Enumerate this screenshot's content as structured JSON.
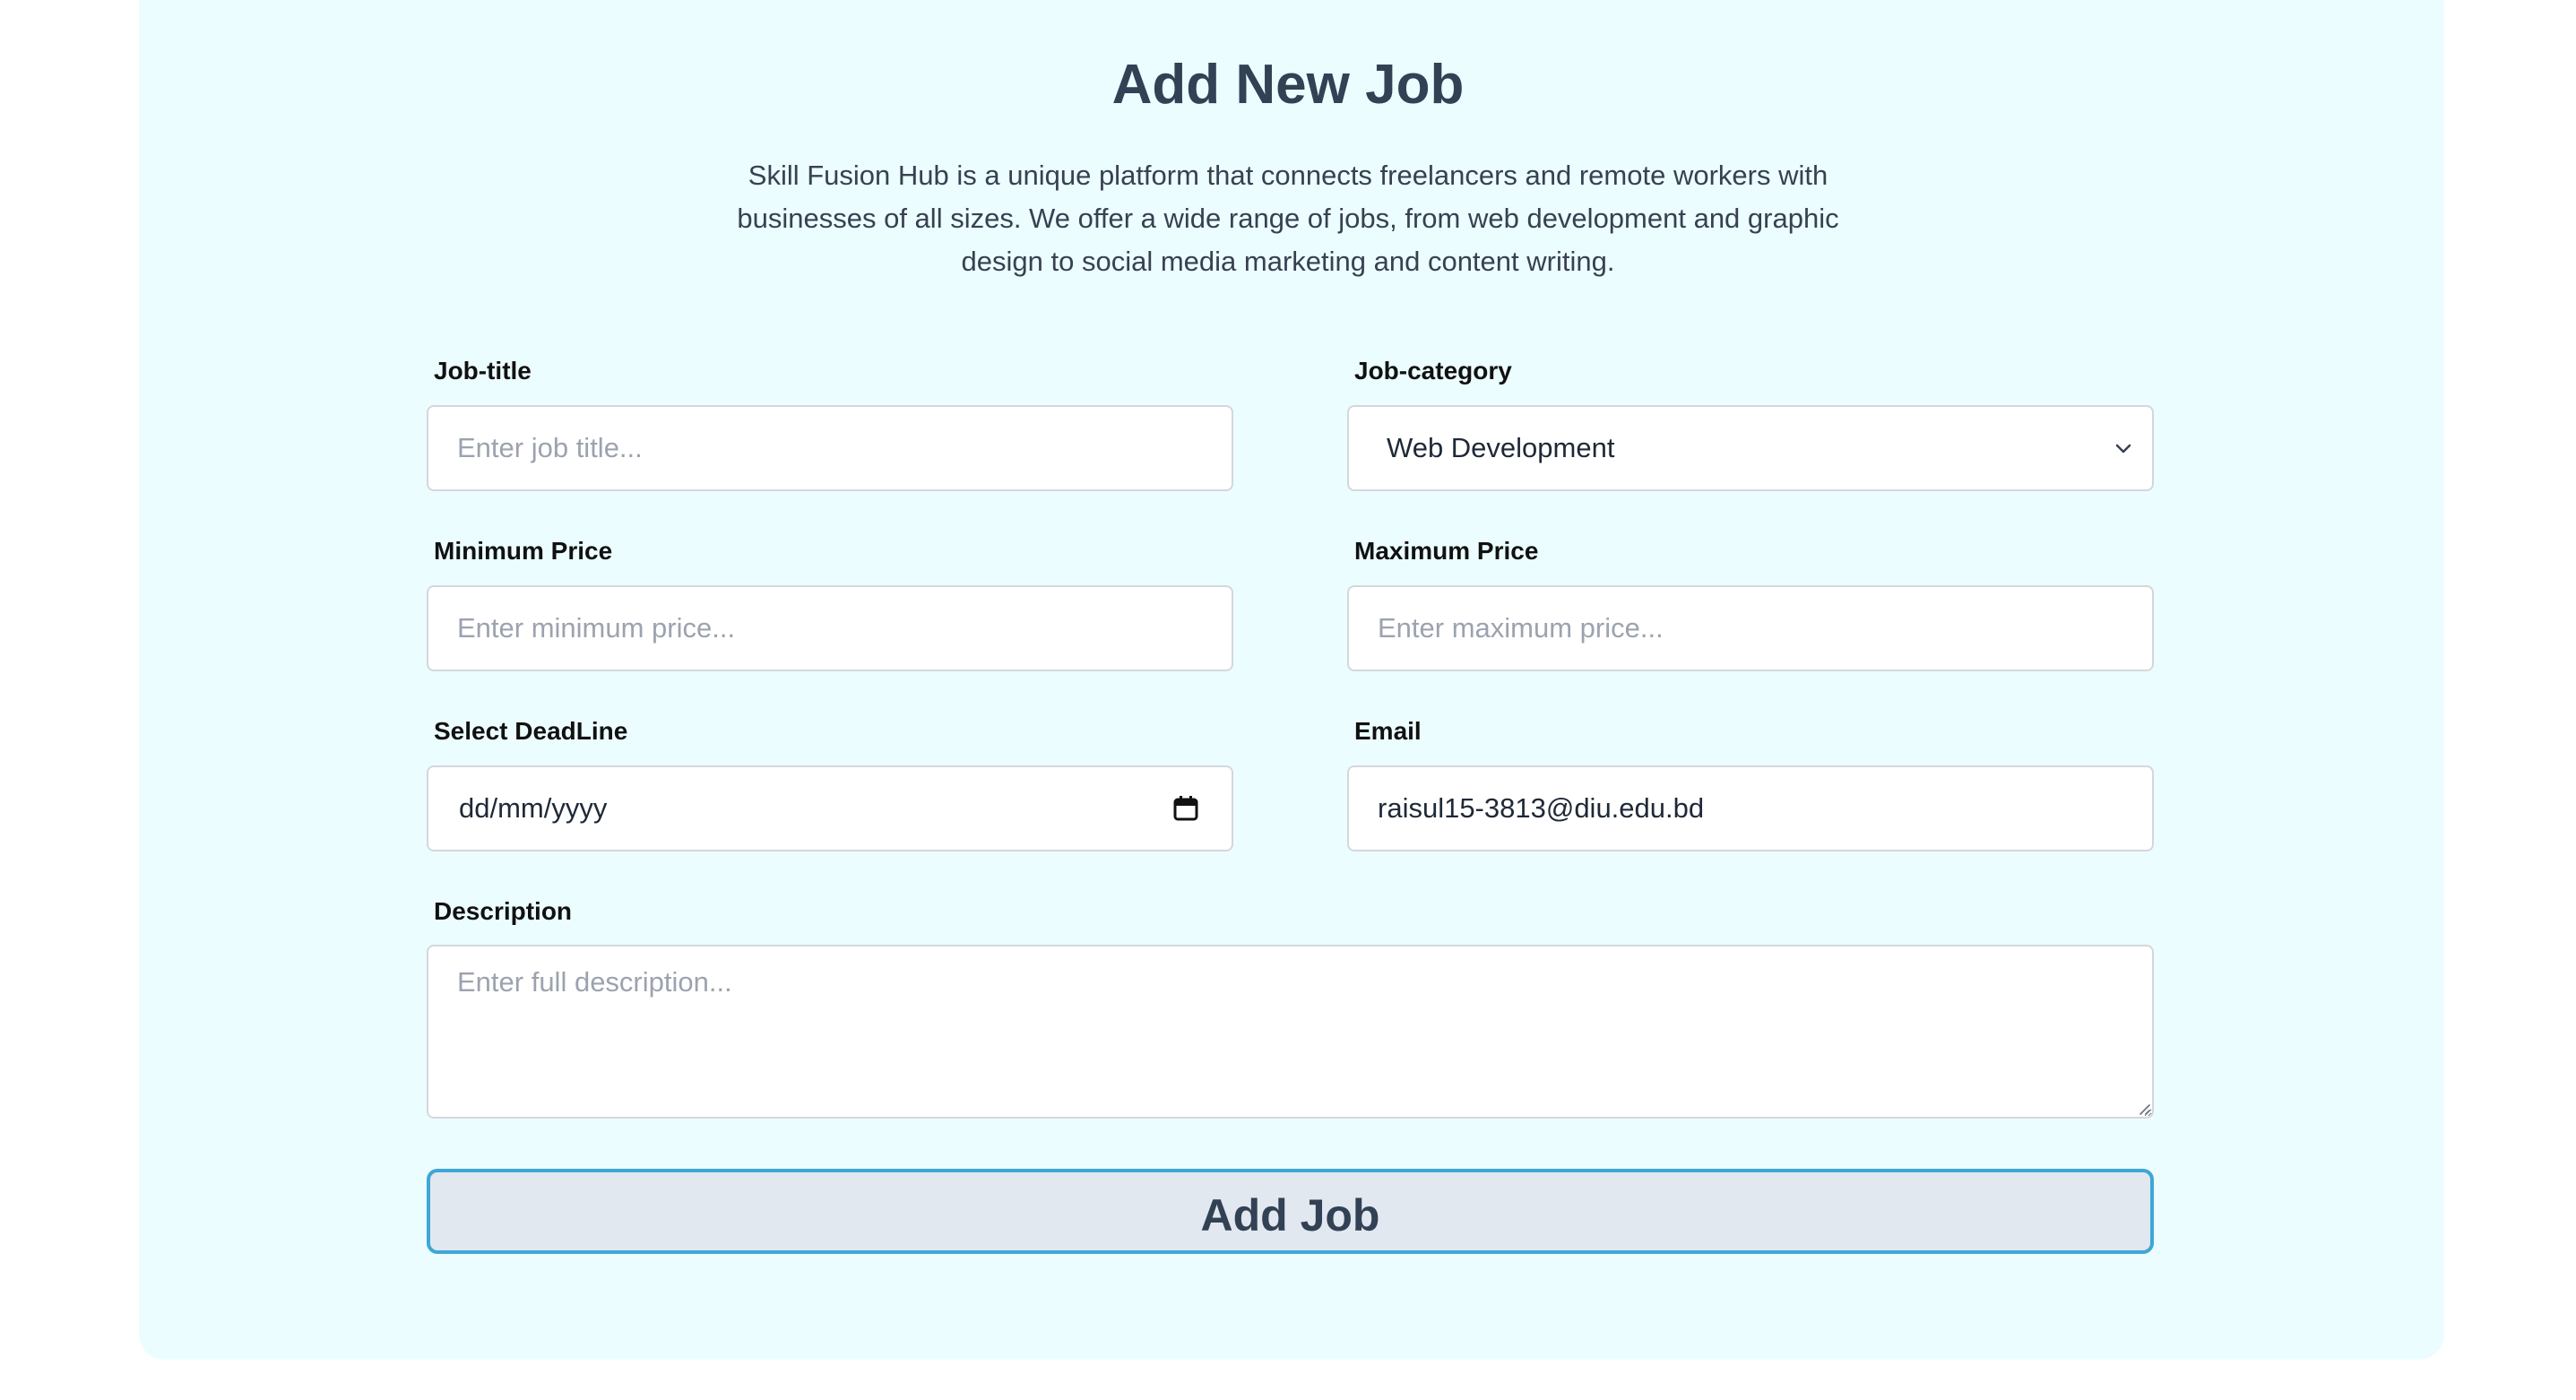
{
  "page": {
    "title": "Add New Job",
    "intro": "Skill Fusion Hub is a unique platform that connects freelancers and remote workers with businesses of all sizes. We offer a wide range of jobs, from web development and graphic design to social media marketing and content writing."
  },
  "form": {
    "job_title": {
      "label": "Job-title",
      "placeholder": "Enter job title..."
    },
    "job_category": {
      "label": "Job-category",
      "selected": "Web Development"
    },
    "min_price": {
      "label": "Minimum Price",
      "placeholder": "Enter minimum price..."
    },
    "max_price": {
      "label": "Maximum Price",
      "placeholder": "Enter maximum price..."
    },
    "deadline": {
      "label": "Select DeadLine",
      "format": "dd/mm/yyyy"
    },
    "email": {
      "label": "Email",
      "value": "raisul15-3813@diu.edu.bd"
    },
    "description": {
      "label": "Description",
      "placeholder": "Enter full description..."
    },
    "submit_label": "Add Job"
  },
  "colors": {
    "card_background": "#ecfdff",
    "heading_text": "#334155",
    "button_background": "#e2e8f0",
    "button_border": "#3ea7d6"
  }
}
